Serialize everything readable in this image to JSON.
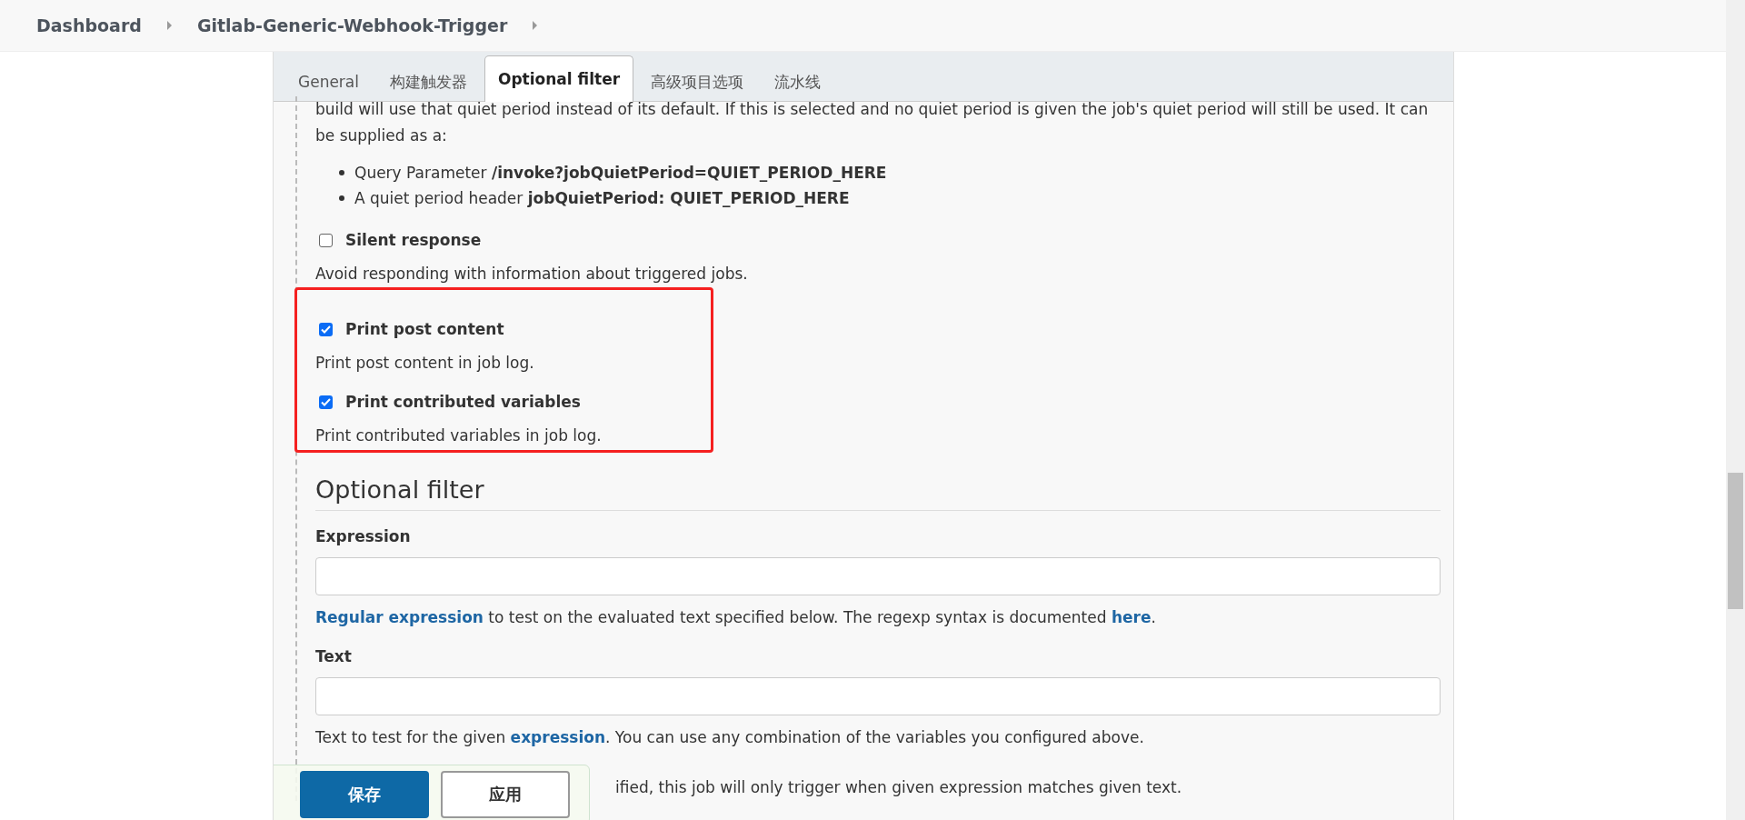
{
  "breadcrumbs": [
    "Dashboard",
    "Gitlab-Generic-Webhook-Trigger"
  ],
  "tabs": [
    {
      "label": "General",
      "selected": false
    },
    {
      "label": "构建触发器",
      "selected": false
    },
    {
      "label": "Optional filter",
      "selected": true
    },
    {
      "label": "高级项目选项",
      "selected": false
    },
    {
      "label": "流水线",
      "selected": false
    }
  ],
  "intro": "build will use that quiet period instead of its default. If this is selected and no quiet period is given the job's quiet period will still be used. It can be supplied as a:",
  "intro_bullets": [
    "Query Parameter **/invoke?jobQuietPeriod=QUIET_PERIOD_HERE**",
    "A quiet period header **jobQuietPeriod: QUIET_PERIOD_HERE**"
  ],
  "options": [
    {
      "label": "Silent response",
      "checked": false,
      "description": "Avoid responding with information about triggered jobs.",
      "highlighted": false
    },
    {
      "label": "Print post content",
      "checked": true,
      "description": "Print post content in job log.",
      "highlighted": true
    },
    {
      "label": "Print contributed variables",
      "checked": true,
      "description": "Print contributed variables in job log.",
      "highlighted": true
    }
  ],
  "section": {
    "title": "Optional filter",
    "fields": [
      {
        "label": "Expression",
        "help": [
          {
            "kind": "link",
            "text": "Regular expression"
          },
          {
            "kind": "text",
            "text": " to test on the evaluated text specified below. The regexp syntax is documented "
          },
          {
            "kind": "link",
            "text": "here"
          },
          {
            "kind": "text",
            "text": "."
          }
        ]
      },
      {
        "label": "Text",
        "help": [
          {
            "kind": "text",
            "text": "Text to test for the given "
          },
          {
            "kind": "link",
            "text": "expression"
          },
          {
            "kind": "text",
            "text": ". You can use any combination of the variables you configured above."
          }
        ]
      }
    ],
    "note": "ified, this job will only trigger when given expression matches given text."
  },
  "buttons": [
    {
      "label": "保存",
      "kind": "primary"
    },
    {
      "label": "应用",
      "kind": "secondary"
    }
  ]
}
